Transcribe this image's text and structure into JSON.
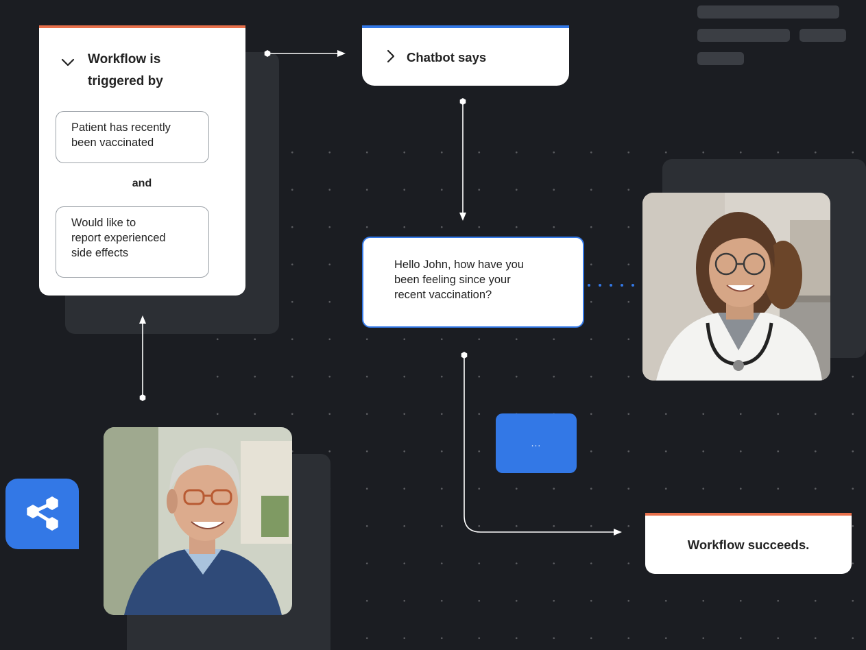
{
  "trigger_card": {
    "title_line1": "Workflow is",
    "title_line2": "triggered by",
    "condition1_line1": "Patient has recently",
    "condition1_line2": "been vaccinated",
    "connector": "and",
    "condition2_line1": "Would like to",
    "condition2_line2": "report experienced",
    "condition2_line3": "side effects"
  },
  "chatbot_card": {
    "title": "Chatbot says"
  },
  "message": {
    "line1": "Hello John, how have you",
    "line2": "been feeling since your",
    "line3": "recent vaccination?"
  },
  "typing_indicator": {
    "text": "..."
  },
  "success_card": {
    "title": "Workflow succeeds."
  },
  "colors": {
    "background": "#1b1d22",
    "accent_blue": "#3378e6",
    "accent_orange": "#e8704b",
    "shadow_panel": "#2c2f34"
  },
  "icons": {
    "trigger_toggle": "chevron-down-icon",
    "chatbot_toggle": "chevron-right-icon",
    "share": "share-nodes-icon"
  }
}
